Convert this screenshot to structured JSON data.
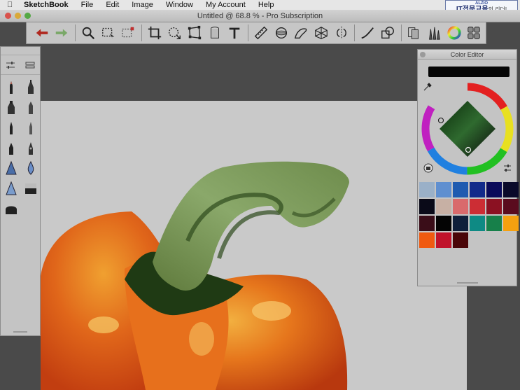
{
  "menubar": {
    "apple": "",
    "app_name": "SketchBook",
    "items": [
      "File",
      "Edit",
      "Image",
      "Window",
      "My Account",
      "Help"
    ]
  },
  "watermark": {
    "small": "ALZIO",
    "large": "IT전문교육",
    "tail": "의 리더!"
  },
  "window": {
    "title": "Untitled @ 68.8 % - Pro Subscription"
  },
  "toolbar": {
    "tools": [
      "undo-icon",
      "redo-icon",
      "zoom-icon",
      "selection-icon",
      "deselect-icon",
      "crop-icon",
      "lasso-transform-icon",
      "distort-icon",
      "canvas-size-icon",
      "text-icon",
      "ruler-icon",
      "ellipse-guide-icon",
      "french-curve-icon",
      "perspective-icon",
      "symmetry-icon",
      "stroke-tool-icon",
      "shape-icon",
      "copic-library-icon",
      "brush-library-icon",
      "color-wheel-icon",
      "layer-editor-icon"
    ]
  },
  "color_editor": {
    "title": "Color Editor",
    "current_color": "#050505",
    "swatches": [
      "#9ab0c8",
      "#5f8fd0",
      "#1f5bb0",
      "#122a8a",
      "#0a0a5a",
      "#0a0a2a",
      "#0a0a18",
      "#c7b0a4",
      "#d96a6c",
      "#cc2d34",
      "#8b1122",
      "#5a0b1e",
      "#3a0d18",
      "#040404",
      "#0f1f3a",
      "#0e8a84",
      "#17804a",
      "#f5a010",
      "#f05a10",
      "#c0122a",
      "#4a0508"
    ]
  },
  "colors": {
    "accent_undo": "#d9352c",
    "accent_redo": "#7cc46a"
  }
}
